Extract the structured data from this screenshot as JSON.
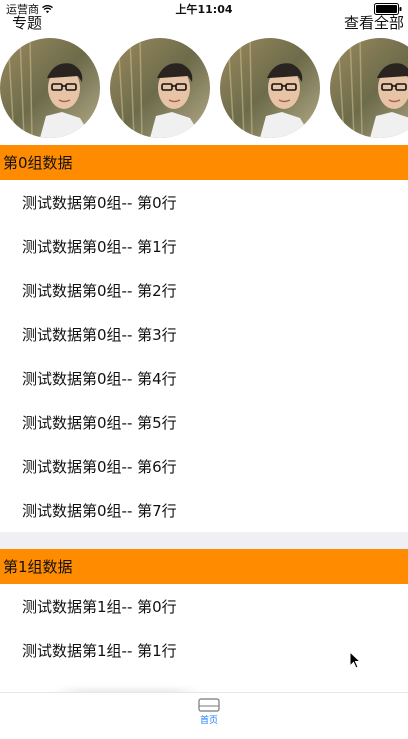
{
  "status_bar": {
    "carrier": "运营商",
    "time": "上午11:04"
  },
  "header": {
    "left_title": "专题",
    "right_action": "查看全部"
  },
  "avatars": [
    {
      "alt": "avatar"
    },
    {
      "alt": "avatar"
    },
    {
      "alt": "avatar"
    },
    {
      "alt": "avatar"
    }
  ],
  "sections": [
    {
      "title": "第0组数据",
      "rows": [
        "测试数据第0组-- 第0行",
        "测试数据第0组-- 第1行",
        "测试数据第0组-- 第2行",
        "测试数据第0组-- 第3行",
        "测试数据第0组-- 第4行",
        "测试数据第0组-- 第5行",
        "测试数据第0组-- 第6行",
        "测试数据第0组-- 第7行"
      ]
    },
    {
      "title": "第1组数据",
      "rows": [
        "测试数据第1组-- 第0行",
        "测试数据第1组-- 第1行"
      ]
    }
  ],
  "tab_bar": {
    "home_label": "首页"
  },
  "colors": {
    "section_header_bg": "#FF8C00",
    "section_gap_bg": "#EFEFF4",
    "tab_active": "#1E7CFF"
  }
}
